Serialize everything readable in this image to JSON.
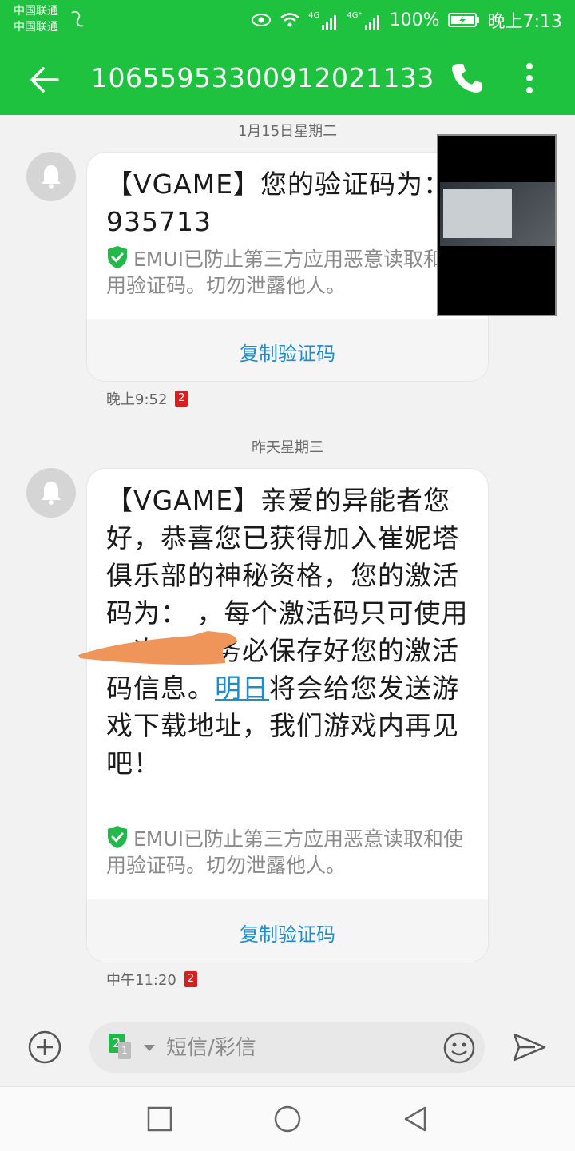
{
  "status_bar": {
    "carrier_1": "中国联通",
    "carrier_2": "中国联通",
    "network_1": "4G",
    "network_2": "4G⁺",
    "battery": "100%",
    "time": "晚上7:13"
  },
  "app_bar": {
    "title": "10655953300912021133",
    "icons": [
      "back-arrow-icon",
      "phone-icon",
      "more-vert-icon"
    ]
  },
  "messages": [
    {
      "date": "1月15日星期二",
      "text": "【VGAME】您的验证码为：  935713",
      "emui_notice": "EMUI已防止第三方应用恶意读取和使用验证码。切勿泄露他人。",
      "copy_label": "复制验证码",
      "time": "晚上9:52",
      "sim": "2"
    },
    {
      "date": "昨天星期三",
      "text_before_link": "【VGAME】亲爱的异能者您好，恭喜您已获得加入崔妮塔俱乐部的神秘资格，您的激活码为：          ，每个激活码只可使用一次，请务必保存好您的激活码信息。",
      "link_text": "明日",
      "text_after_link": "将会给您发送游戏下载地址，我们游戏内再见吧！",
      "emui_notice": "EMUI已防止第三方应用恶意读取和使用验证码。切勿泄露他人。",
      "copy_label": "复制验证码",
      "time": "中午11:20",
      "sim": "2"
    }
  ],
  "input_bar": {
    "sim_selected": "2",
    "sim_other": "1",
    "placeholder": "短信/彩信"
  },
  "colors": {
    "accent": "#1ec23e",
    "link": "#1a8ecf",
    "sim_badge": "#d81e1e",
    "redaction": "#f0955a"
  }
}
